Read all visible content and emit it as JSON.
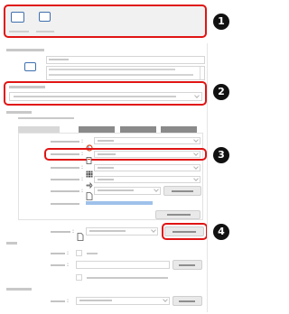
{
  "callouts": {
    "one": "1",
    "two": "2",
    "three": "3",
    "four": "4"
  },
  "colors": {
    "highlight": "#e01414",
    "badge": "#111111",
    "accent_bar": "#9ec1ea",
    "icon_blue": "#3f6fae",
    "tab_dark": "#8a8a8a"
  },
  "icons": [
    "layout-icon",
    "palette-icon",
    "document-icon",
    "grid-icon",
    "link-icon",
    "file-icon"
  ]
}
